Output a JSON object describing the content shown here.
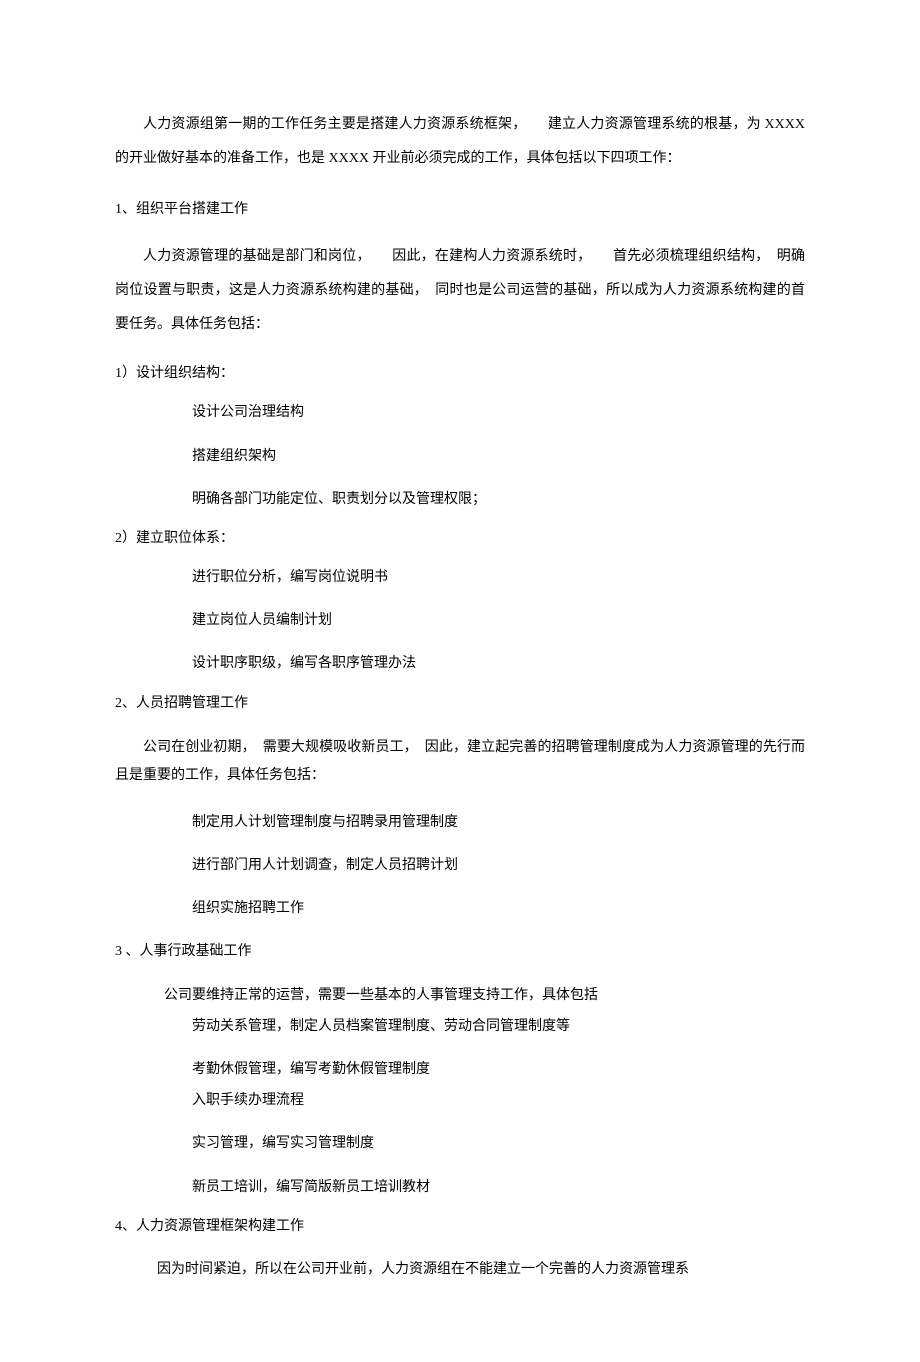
{
  "intro": "人力资源组第一期的工作任务主要是搭建人力资源系统框架，　　建立人力资源管理系统的根基，为 XXXX 的开业做好基本的准备工作，也是 XXXX 开业前必须完成的工作，具体包括以下四项工作：",
  "sections": {
    "s1": {
      "heading": "1、组织平台搭建工作",
      "para": "人力资源管理的基础是部门和岗位，　　因此，在建构人力资源系统时，　　首先必须梳理组织结构，　明确岗位设置与职责，这是人力资源系统构建的基础，　同时也是公司运营的基础，所以成为人力资源系统构建的首要任务。具体任务包括：",
      "sub1": {
        "heading": "1）设计组织结构：",
        "items": [
          "设计公司治理结构",
          "搭建组织架构",
          "明确各部门功能定位、职责划分以及管理权限；"
        ]
      },
      "sub2": {
        "heading": "2）建立职位体系：",
        "items": [
          "进行职位分析，编写岗位说明书",
          "建立岗位人员编制计划",
          "设计职序职级，编写各职序管理办法"
        ]
      }
    },
    "s2": {
      "heading": "2、人员招聘管理工作",
      "para": "公司在创业初期，　需要大规模吸收新员工，　因此，建立起完善的招聘管理制度成为人力资源管理的先行而且是重要的工作，具体任务包括：",
      "items": [
        "制定用人计划管理制度与招聘录用管理制度",
        "进行部门用人计划调查，制定人员招聘计划",
        "组织实施招聘工作"
      ]
    },
    "s3": {
      "heading": "3 、人事行政基础工作",
      "intro": "公司要维持正常的运营，需要一些基本的人事管理支持工作，具体包括",
      "items": [
        "劳动关系管理，制定人员档案管理制度、劳动合同管理制度等",
        "考勤休假管理，编写考勤休假管理制度",
        "入职手续办理流程",
        "实习管理，编写实习管理制度",
        "新员工培训，编写简版新员工培训教材"
      ]
    },
    "s4": {
      "heading": "4、人力资源管理框架构建工作",
      "para": "因为时间紧迫，所以在公司开业前，人力资源组在不能建立一个完善的人力资源管理系"
    }
  }
}
